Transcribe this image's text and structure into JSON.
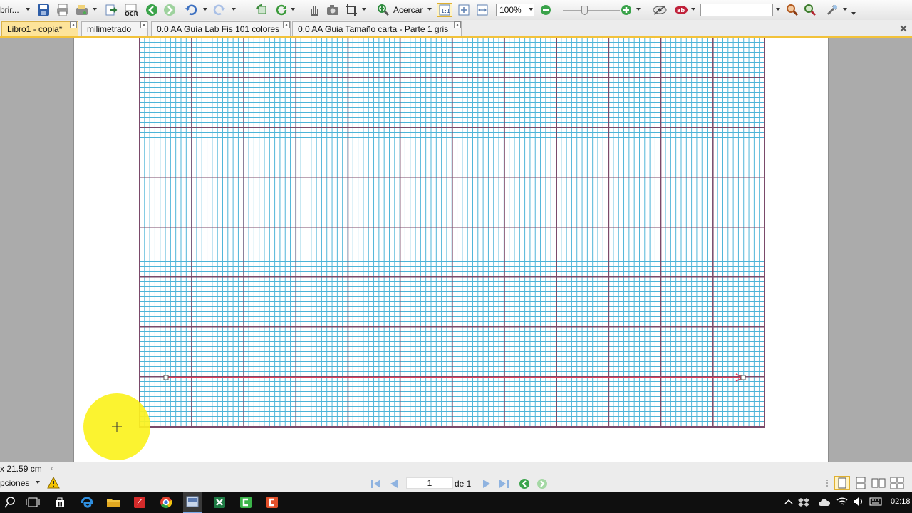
{
  "toolbar": {
    "open_label": "brir...",
    "zoom_in_label": "Acercar",
    "zoom_value": "100%",
    "search_value": ""
  },
  "tabs": [
    {
      "label": "Libro1 - copia*",
      "active": true
    },
    {
      "label": "milimetrado",
      "active": false
    },
    {
      "label": "0.0 AA  Guía Lab Fis 101 colores",
      "active": false
    },
    {
      "label": "0.0 AA  Guia Tamaño carta - Parte 1 gris",
      "active": false
    }
  ],
  "status": {
    "page_size": "x 21.59 cm",
    "options_label": "pciones",
    "current_page": "1",
    "page_of": "de 1"
  },
  "taskbar": {
    "clock": "02:18"
  },
  "colors": {
    "grid_fine": "#4cb4d8",
    "grid_major": "#7a4a6a",
    "arrow": "#e0405a",
    "highlight": "#fbf21e",
    "active_tab": "#fde49a"
  }
}
